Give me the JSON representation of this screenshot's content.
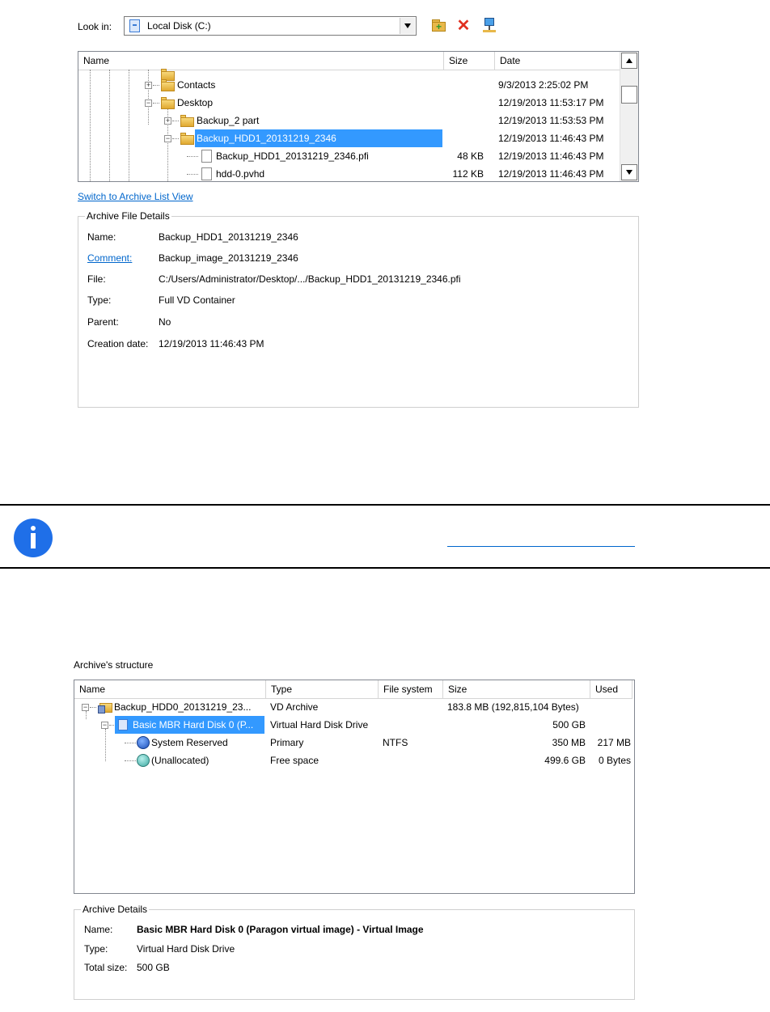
{
  "browser": {
    "look_in_label": "Look in:",
    "look_in_value": "Local Disk (C:)",
    "columns": {
      "name": "Name",
      "size": "Size",
      "date": "Date"
    },
    "rows": [
      {
        "name": "Contacts",
        "size": "",
        "date": "9/3/2013 2:25:02 PM"
      },
      {
        "name": "Desktop",
        "size": "",
        "date": "12/19/2013 11:53:17 PM"
      },
      {
        "name": "Backup_2 part",
        "size": "",
        "date": "12/19/2013 11:53:53 PM"
      },
      {
        "name": "Backup_HDD1_20131219_2346",
        "size": "",
        "date": "12/19/2013 11:46:43 PM"
      },
      {
        "name": "Backup_HDD1_20131219_2346.pfi",
        "size": "48 KB",
        "date": "12/19/2013 11:46:43 PM"
      },
      {
        "name": "hdd-0.pvhd",
        "size": "112 KB",
        "date": "12/19/2013 11:46:43 PM"
      }
    ],
    "switch_link": "Switch to Archive List View"
  },
  "file_details": {
    "title": "Archive File Details",
    "name_label": "Name:",
    "name_value": "Backup_HDD1_20131219_2346",
    "comment_label": "Comment:",
    "comment_value": "Backup_image_20131219_2346",
    "file_label": "File:",
    "file_value": "C:/Users/Administrator/Desktop/.../Backup_HDD1_20131219_2346.pfi",
    "type_label": "Type:",
    "type_value": "Full VD Container",
    "parent_label": "Parent:",
    "parent_value": "No",
    "creation_label": "Creation date:",
    "creation_value": "12/19/2013 11:46:43 PM"
  },
  "structure": {
    "title": "Archive's structure",
    "columns": {
      "name": "Name",
      "type": "Type",
      "fs": "File system",
      "size": "Size",
      "used": "Used"
    },
    "rows": [
      {
        "name": "Backup_HDD0_20131219_23...",
        "type": "VD Archive",
        "fs": "",
        "size": "183.8 MB (192,815,104 Bytes)",
        "used": ""
      },
      {
        "name": "Basic MBR Hard Disk 0 (P...",
        "type": "Virtual Hard Disk Drive",
        "fs": "",
        "size": "500 GB",
        "used": ""
      },
      {
        "name": "System Reserved",
        "type": "Primary",
        "fs": "NTFS",
        "size": "350 MB",
        "used": "217 MB"
      },
      {
        "name": "(Unallocated)",
        "type": "Free space",
        "fs": "",
        "size": "499.6 GB",
        "used": "0 Bytes"
      }
    ]
  },
  "archive_details": {
    "title": "Archive Details",
    "name_label": "Name:",
    "name_value": "Basic MBR Hard Disk 0 (Paragon virtual image) - Virtual Image",
    "type_label": "Type:",
    "type_value": "Virtual Hard Disk Drive",
    "size_label": "Total size:",
    "size_value": "500 GB"
  },
  "colors": {
    "selection": "#3399ff",
    "link": "#0066cc",
    "info": "#1f6fe8"
  }
}
